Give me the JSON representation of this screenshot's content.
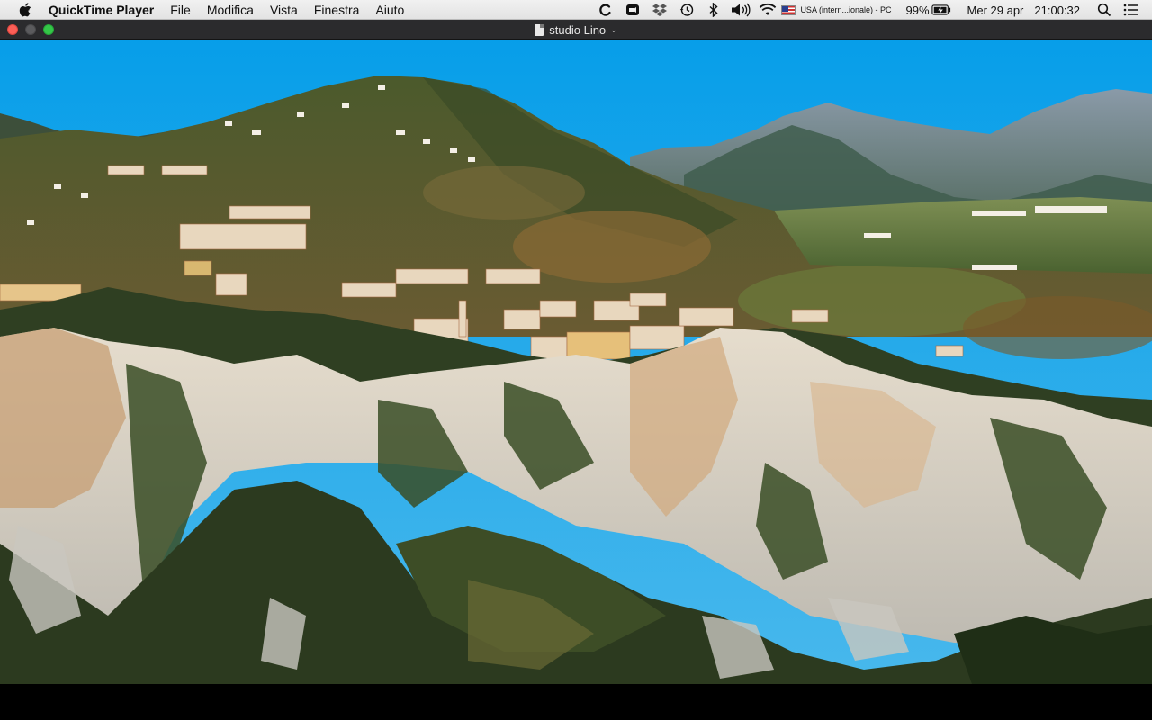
{
  "menubar": {
    "app_name": "QuickTime Player",
    "items": [
      "File",
      "Modifica",
      "Vista",
      "Finestra",
      "Aiuto"
    ],
    "status": {
      "input_source": "USA (intern...ionale) - PC",
      "battery": "99%",
      "date": "Mer 29 apr",
      "time": "21:00:32"
    }
  },
  "window": {
    "title": "studio Lino"
  },
  "colors": {
    "sky": "#12a8ef",
    "close": "#fc5f57",
    "maximize": "#34c748"
  }
}
